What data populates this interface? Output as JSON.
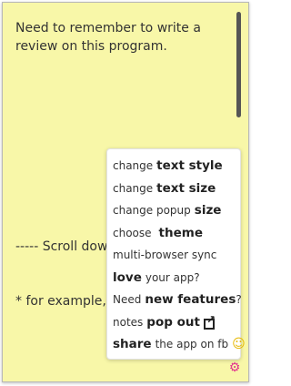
{
  "note": {
    "text": "Need to remember to write a review on this program.\n\n\n\n\n\n\n\n\n\n\n----- Scroll down\n\n\n* for example, y"
  },
  "menu": {
    "items": [
      {
        "lead": "change",
        "strong": "text style"
      },
      {
        "lead": "change",
        "strong": "text size"
      },
      {
        "lead": "change popup",
        "strong": "size"
      },
      {
        "lead": "choose",
        "strong": "theme"
      },
      {
        "lead": "multi-browser sync",
        "strong": ""
      },
      {
        "lead": "your app?",
        "strong": "love"
      },
      {
        "lead": "Need",
        "strong": "new features",
        "tail": "?"
      },
      {
        "lead": "notes",
        "strong": "pop out"
      },
      {
        "lead": "the app on fb",
        "strong": "share"
      }
    ]
  },
  "icons": {
    "popout": "external-link-icon",
    "emoji": "smiley-thumbs-up-icon",
    "gear": "gear-icon"
  },
  "colors": {
    "note_bg": "#f8f7a8",
    "gear": "#e1338f"
  }
}
